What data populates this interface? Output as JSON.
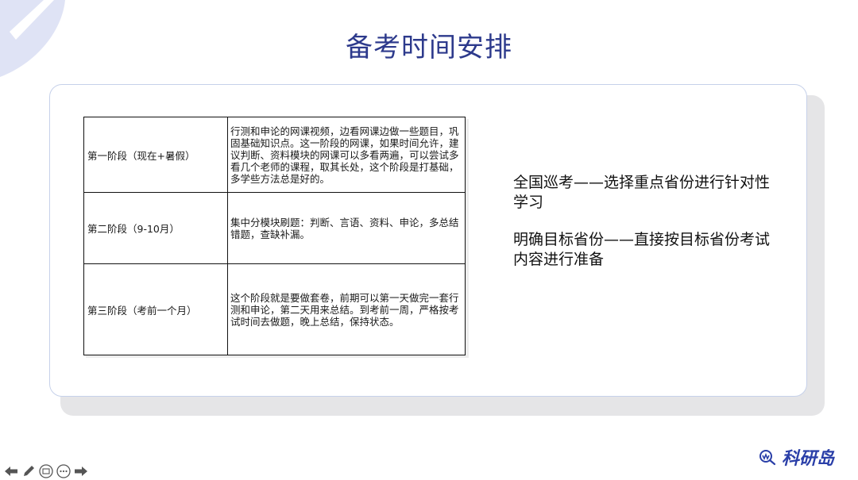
{
  "slide": {
    "title": "备考时间安排"
  },
  "table": {
    "rows": [
      {
        "stage": "第一阶段（现在+暑假）",
        "desc": "行测和申论的网课视频，边看网课边做一些题目，巩固基础知识点。这一阶段的网课，如果时间允许，建议判断、资料模块的网课可以多看两遍，可以尝试多看几个老师的课程，取其长处，这个阶段是打基础，多学些方法总是好的。"
      },
      {
        "stage": "第二阶段（9-10月）",
        "desc": "集中分模块刷题：判断、言语、资料、申论，多总结错题，查缺补漏。"
      },
      {
        "stage": "第三阶段（考前一个月）",
        "desc": "这个阶段就是要做套卷，前期可以第一天做完一套行测和申论，第二天用来总结。到考前一周，严格按考试时间去做题，晚上总结，保持状态。"
      }
    ]
  },
  "notes": {
    "note1": "全国巡考——选择重点省份进行针对性学习",
    "note2": "明确目标省份——直接按目标省份考试内容进行准备"
  },
  "logo": {
    "text": "科研岛"
  },
  "nav": {
    "icons": [
      "prev-arrow-icon",
      "pen-icon",
      "slides-icon",
      "more-icon",
      "next-arrow-icon"
    ]
  },
  "colors": {
    "title": "#2d3a8c",
    "accent": "#2a3fa8",
    "card_border": "#c6d1ea"
  }
}
